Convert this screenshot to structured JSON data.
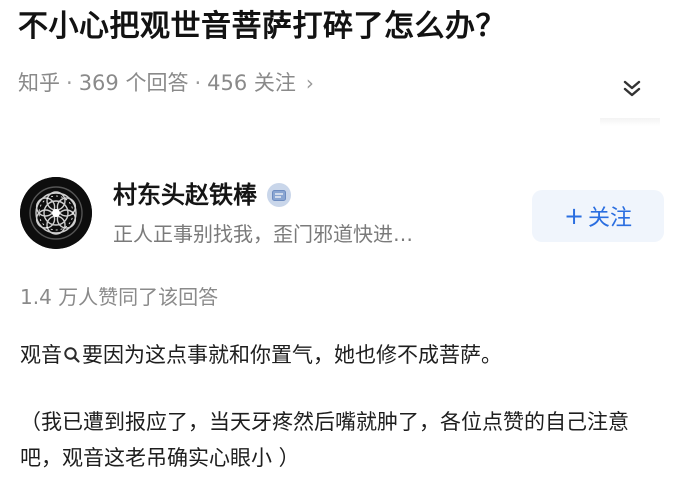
{
  "question": {
    "title": "不小心把观世音菩萨打碎了怎么办？",
    "source": "知乎",
    "separator": "·",
    "answers_count": "369 个回答",
    "followers_count": "456 关注",
    "more_arrow": "›"
  },
  "icons": {
    "expand": "chevron-double-down-icon",
    "search_inline": "search-icon",
    "verified_badge": "badge-icon"
  },
  "author": {
    "name": "村东头赵铁棒",
    "bio": "正人正事别找我，歪门邪道快进…",
    "follow_plus": "+",
    "follow_label": "关注"
  },
  "answer": {
    "likes_text": "1.4 万人赞同了该回答",
    "line1_before": "观音",
    "line1_after": "要因为这点事就和你置气，她也修不成菩萨。",
    "note": "（我已遭到报应了，当天牙疼然后嘴就肿了，各位点赞的自己注意吧，观音这老吊确实心眼小 ）"
  },
  "colors": {
    "accent": "#2a6ee0",
    "follow_bg": "#f0f5fc",
    "muted_text": "#8a8a8a",
    "title_text": "#121212"
  }
}
